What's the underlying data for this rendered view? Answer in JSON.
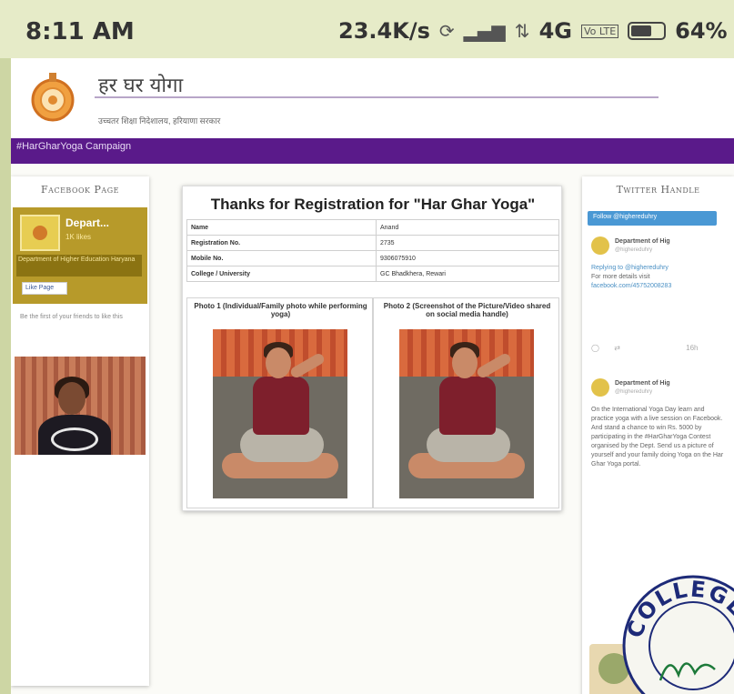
{
  "status_bar": {
    "time": "8:11 AM",
    "net_speed": "23.4K/s",
    "network": "4G",
    "volte": "Vo LTE",
    "battery": "64%",
    "battery_level": 0.64
  },
  "header": {
    "title": "हर घर योगा",
    "subtitle": "उच्चतर शिक्षा निदेशालय, हरियाणा सरकार",
    "nav_text": "#HarGharYoga Campaign"
  },
  "facebook": {
    "heading": "Facebook Page",
    "page_name": "Depart...",
    "likes": "1K likes",
    "strip_text": "Department of Higher Education Haryana",
    "like_button": "Like Page",
    "friends_text": "Be the first of your friends to like this"
  },
  "registration": {
    "title": "Thanks for Registration for \"Har Ghar Yoga\"",
    "rows": [
      {
        "key": "Name",
        "value": "Anand"
      },
      {
        "key": "Registration No.",
        "value": "2735"
      },
      {
        "key": "Mobile No.",
        "value": "9306075910"
      },
      {
        "key": "College / University",
        "value": "GC Bhadkhera, Rewari"
      }
    ],
    "photo1_caption": "Photo 1 (Individual/Family photo while performing yoga)",
    "photo2_caption": "Photo 2 (Screenshot of the Picture/Video shared on social media handle)"
  },
  "twitter": {
    "heading": "Twitter Handle",
    "follow_button": "Follow @highereduhry",
    "tweets": [
      {
        "user": "Department of Hig",
        "handle": "@highereduhry",
        "replying": "Replying to @highereduhry",
        "body": "For more details visit",
        "link": "facebook.com/45752008283",
        "time": "16h"
      },
      {
        "user": "Department of Hig",
        "handle": "@highereduhry",
        "body": "On the International Yoga Day learn and practice yoga with a live session on Facebook. And stand a chance to win Rs. 5000 by participating in the #HarGharYoga Contest organised by the Dept. Send us a picture of yourself and your family doing Yoga on the Har Ghar Yoga portal."
      }
    ]
  },
  "seal": {
    "text": "COLLEGE"
  }
}
